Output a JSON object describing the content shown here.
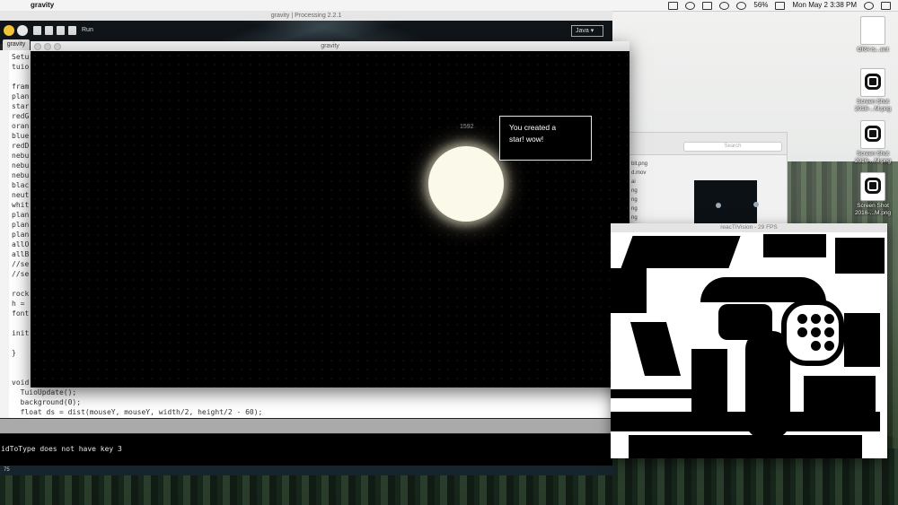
{
  "menubar": {
    "app_name": "gravity",
    "clock": "Mon May 2  3:38 PM",
    "battery": "56%"
  },
  "ide": {
    "title": "gravity | Processing 2.2.1",
    "run_label": "Run",
    "mode": "Java ▾",
    "tab": "gravity",
    "code": [
      "Setu",
      "tuio",
      "",
      "fram",
      "plan",
      "star",
      "redG",
      "oran",
      "blue",
      "redD",
      "nebu",
      "nebu",
      "nebu",
      "blac",
      "neut",
      "whit",
      "plan",
      "plan",
      "plan",
      "allO",
      "allB",
      "//se",
      "//se",
      "",
      "rock",
      "h =",
      "font",
      "",
      "init",
      "",
      "}",
      "",
      "",
      "void d",
      "  TuioUpdate();",
      "  background(0);",
      "  float ds = dist(mouseY, mouseY, width/2, height/2 - 60);"
    ],
    "console": "idToType does not have key 3",
    "line_number": "75"
  },
  "sketch": {
    "title": "gravity",
    "counter": "1592",
    "tooltip_line1": "You created a",
    "tooltip_line2": "star! wow!"
  },
  "finder": {
    "search_placeholder": "Search",
    "files": [
      "bit.png",
      "d.mov",
      "ai",
      "",
      "ng",
      "ng",
      "ng",
      "ng"
    ]
  },
  "reactivision": {
    "title": "reacTIVision - 29 FPS"
  },
  "desktop_icons": [
    {
      "label": "GRA Is...ent",
      "type": "doc"
    },
    {
      "label": "Screen Shot 2016-...M.png",
      "type": "marker"
    },
    {
      "label": "Screen Shot 2016-...M.png",
      "type": "marker"
    },
    {
      "label": "Screen Shot 2016-...M.png",
      "type": "marker"
    }
  ],
  "colors": {
    "run_button": "#f2c23a",
    "star": "#fbf9ea",
    "canvas": "#000000"
  }
}
